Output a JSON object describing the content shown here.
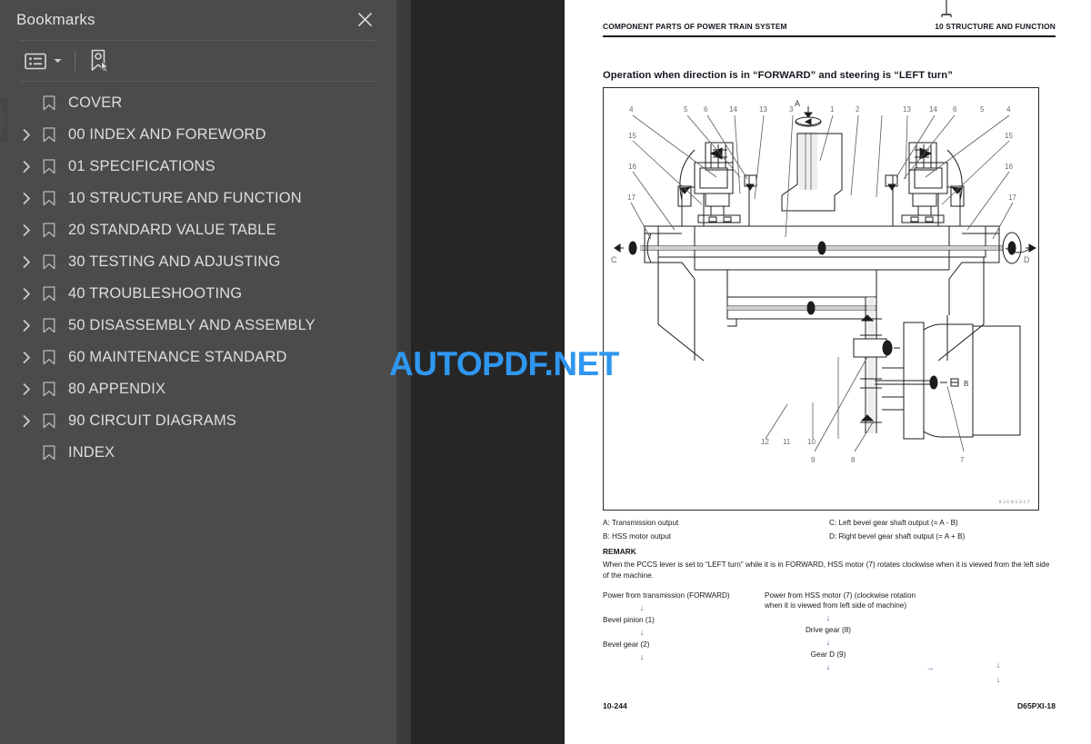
{
  "sidebar": {
    "title": "Bookmarks",
    "close_icon": "close-icon",
    "toolbar": {
      "list_options_icon": "list-options-icon",
      "caret_icon": "chevron-down-icon",
      "new_bookmark_icon": "new-bookmark-icon"
    },
    "items": [
      {
        "label": "COVER",
        "expandable": false
      },
      {
        "label": "00 INDEX AND FOREWORD",
        "expandable": true
      },
      {
        "label": "01 SPECIFICATIONS",
        "expandable": true
      },
      {
        "label": "10 STRUCTURE AND FUNCTION",
        "expandable": true
      },
      {
        "label": "20 STANDARD VALUE TABLE",
        "expandable": true
      },
      {
        "label": "30 TESTING AND ADJUSTING",
        "expandable": true
      },
      {
        "label": "40 TROUBLESHOOTING",
        "expandable": true
      },
      {
        "label": "50 DISASSEMBLY AND ASSEMBLY",
        "expandable": true
      },
      {
        "label": "60 MAINTENANCE STANDARD",
        "expandable": true
      },
      {
        "label": "80 APPENDIX",
        "expandable": true
      },
      {
        "label": "90 CIRCUIT DIAGRAMS",
        "expandable": true
      },
      {
        "label": "INDEX",
        "expandable": false
      }
    ]
  },
  "watermark": {
    "text": "AUTOPDF.NET",
    "color": "#2f97f0"
  },
  "document": {
    "header_left": "COMPONENT PARTS OF POWER TRAIN SYSTEM",
    "header_right": "10 STRUCTURE AND FUNCTION",
    "section_title": "Operation when direction is in “FORWARD” and steering is “LEFT turn”",
    "figure_code": "9JC01317",
    "figure_callouts": [
      "1",
      "2",
      "3",
      "4",
      "5",
      "6",
      "7",
      "8",
      "9",
      "10",
      "11",
      "12",
      "13",
      "14",
      "15",
      "16",
      "17"
    ],
    "figure_port_labels": [
      "A",
      "B",
      "C",
      "D"
    ],
    "legend": [
      {
        "left": "A: Transmission output",
        "right": "C: Left bevel gear shaft output (= A - B)"
      },
      {
        "left": "B: HSS motor output",
        "right": "D: Right bevel gear shaft output (= A + B)"
      }
    ],
    "remark_heading": "REMARK",
    "remark_text": "When the PCCS lever is set to “LEFT turn” while it is in FORWARD, HSS motor (7) rotates clockwise when it is viewed from the left side of the machine.",
    "flow": {
      "col_a": {
        "heading": "Power from transmission (FORWARD)",
        "steps": [
          "Bevel pinion (1)",
          "Bevel gear (2)"
        ],
        "arrow": "↓"
      },
      "col_b": {
        "heading": "Power from HSS motor (7) (clockwise rotation when it is viewed from left side of machine)",
        "steps": [
          "Drive gear (8)",
          "Gear D (9)"
        ],
        "arrow": "↓"
      },
      "col_c": {
        "arrow": "→"
      },
      "col_d": {
        "arrow": "↓"
      }
    },
    "footer_left": "10-244",
    "footer_right": "D65PXI-18"
  }
}
